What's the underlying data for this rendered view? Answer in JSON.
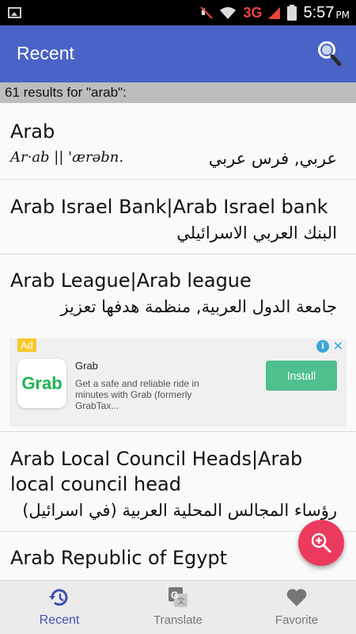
{
  "status_bar": {
    "network": "3G",
    "time": "5:57",
    "ampm": "PM"
  },
  "app_bar": {
    "title": "Recent",
    "search_icon": "search-icon"
  },
  "results": {
    "count_text": "61 results for \"arab\":"
  },
  "entries": [
    {
      "term": "Arab",
      "pronunciation": "Ar·ab || 'ærəbn.",
      "translation": "عربي, فرس عربي"
    },
    {
      "term": "Arab Israel Bank|Arab Israel bank",
      "translation": "البنك العربي الاسرائيلي"
    },
    {
      "term": "Arab League|Arab league",
      "translation": "جامعة الدول العربية, منظمة هدفها تعزيز"
    },
    {
      "term_line1": "Arab Local Council Heads|Arab",
      "term_line2": "local council head",
      "translation": "رؤساء المجالس المحلية العربية (في اسرائيل)"
    },
    {
      "term": "Arab Republic of Egypt"
    }
  ],
  "ad": {
    "badge": "Ad",
    "logo_text": "Grab",
    "app_name": "Grab",
    "description": "Get a safe and reliable ride in minutes with Grab (formerly GrabTax...",
    "install_label": "Install"
  },
  "bottom_nav": [
    {
      "label": "Recent",
      "icon": "history-icon",
      "active": true
    },
    {
      "label": "Translate",
      "icon": "translate-icon",
      "active": false
    },
    {
      "label": "Favorite",
      "icon": "heart-icon",
      "active": false
    }
  ],
  "colors": {
    "app_bar": "#4a63c6",
    "fab": "#ec3a5f",
    "active_nav": "#3f51b5",
    "results_bar": "#bdbdbd"
  }
}
